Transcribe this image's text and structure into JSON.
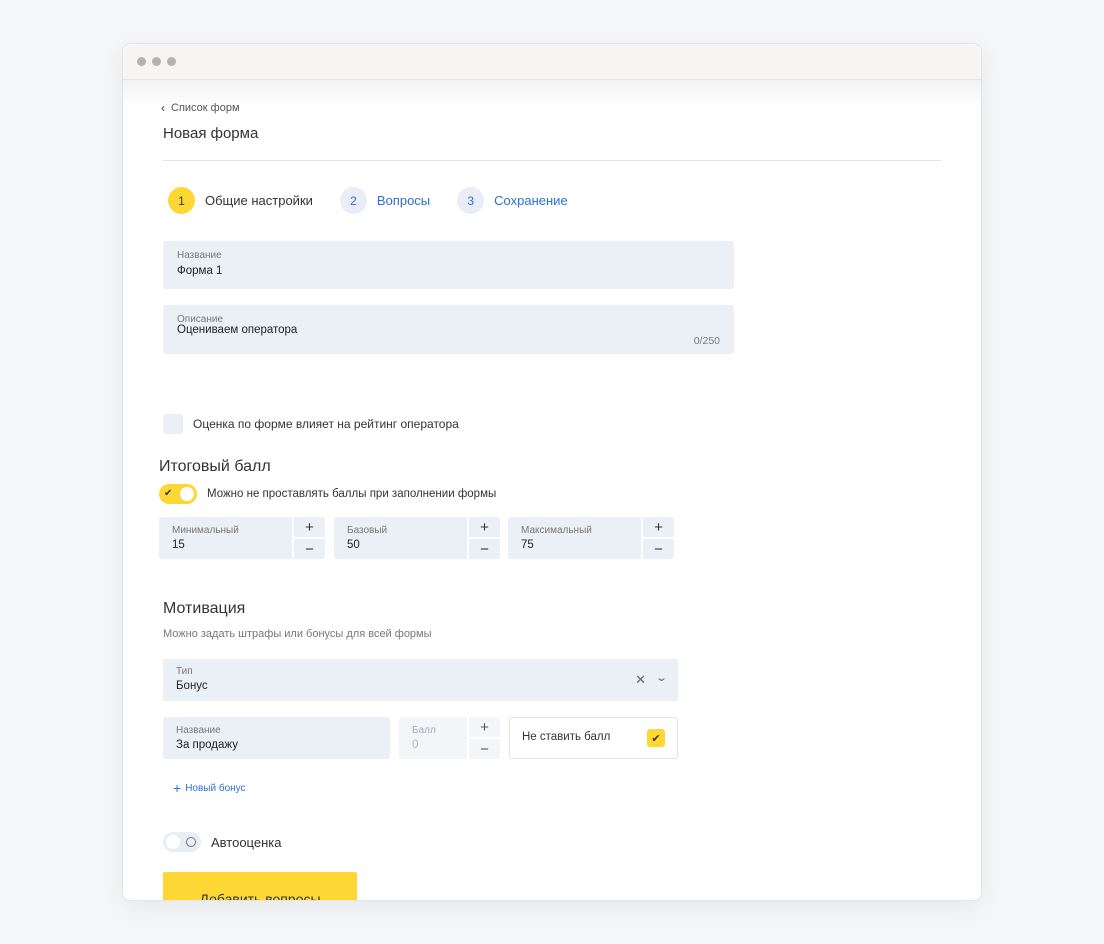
{
  "breadcrumb": {
    "back_label": "Список форм"
  },
  "page": {
    "title": "Новая форма"
  },
  "stepper": [
    {
      "num": "1",
      "label": "Общие настройки",
      "active": true
    },
    {
      "num": "2",
      "label": "Вопросы",
      "active": false
    },
    {
      "num": "3",
      "label": "Сохранение",
      "active": false
    }
  ],
  "form": {
    "name": {
      "label": "Название",
      "value": "Форма 1"
    },
    "description": {
      "label": "Описание",
      "value": "Оцениваем оператора",
      "counter": "0/250"
    },
    "rating_checkbox": {
      "label": "Оценка по форме влияет на рейтинг оператора",
      "checked": false
    }
  },
  "score": {
    "title": "Итоговый балл",
    "toggle": {
      "label": "Можно не проставлять баллы при заполнении формы",
      "on": true
    },
    "fields": [
      {
        "label": "Минимальный",
        "value": "15"
      },
      {
        "label": "Базовый",
        "value": "50"
      },
      {
        "label": "Максимальный",
        "value": "75"
      }
    ],
    "plus": "+",
    "minus": "−"
  },
  "motivation": {
    "title": "Мотивация",
    "subtitle": "Можно задать штрафы или бонусы для всей формы",
    "type": {
      "label": "Тип",
      "value": "Бонус"
    },
    "bonus_name": {
      "label": "Название",
      "value": "За продажу"
    },
    "points": {
      "label": "Балл",
      "value": "0"
    },
    "no_score": {
      "label": "Не ставить балл",
      "checked": true
    },
    "add_bonus": "Новый бонус"
  },
  "auto": {
    "label": "Автооценка",
    "on": false
  },
  "actions": {
    "primary": "Добавить вопросы"
  },
  "colors": {
    "accent": "#fdd835",
    "link": "#2f6fd0",
    "field_bg": "#ebeff6"
  },
  "icons": {
    "back": "chevron-left-icon",
    "clear": "close-icon",
    "dropdown": "chevron-down-icon",
    "check": "check-icon",
    "add": "plus-icon"
  }
}
